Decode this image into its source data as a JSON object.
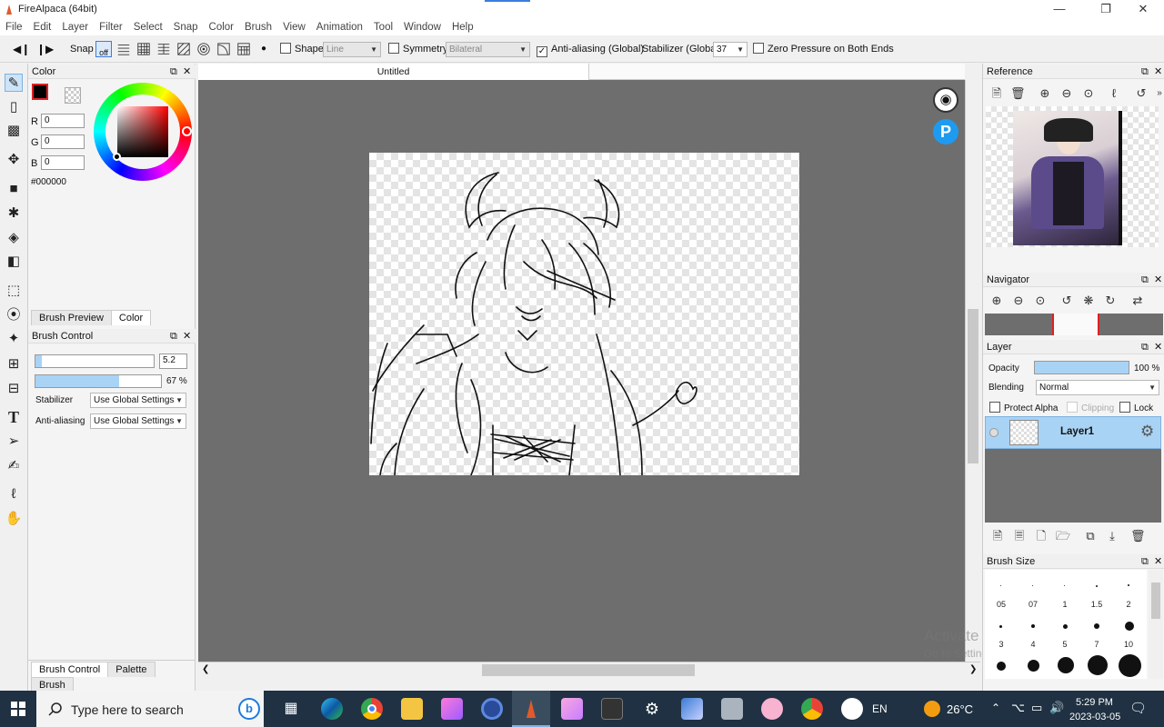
{
  "window": {
    "title": "FireAlpaca (64bit)"
  },
  "menu": [
    "File",
    "Edit",
    "Layer",
    "Filter",
    "Select",
    "Snap",
    "Color",
    "Brush",
    "View",
    "Animation",
    "Tool",
    "Window",
    "Help"
  ],
  "toolbar": {
    "snap_label": "Snap",
    "snap_off": "off",
    "shape_label": "Shape",
    "shape_value": "Line",
    "symmetry_label": "Symmetry",
    "symmetry_value": "Bilateral",
    "antialias_label": "Anti-aliasing (Global)",
    "stabilizer_label": "Stabilizer (Global)",
    "stabilizer_value": "37",
    "zero_pressure_label": "Zero Pressure on Both Ends"
  },
  "color_panel": {
    "title": "Color",
    "r_label": "R",
    "g_label": "G",
    "b_label": "B",
    "r": "0",
    "g": "0",
    "b": "0",
    "hex": "#000000"
  },
  "left_tabs": {
    "preview": "Brush Preview",
    "color": "Color"
  },
  "brush_control": {
    "title": "Brush Control",
    "size_value": "5.2",
    "opacity_value": "67 %",
    "opacity_fraction": 0.67,
    "stabilizer_label": "Stabilizer",
    "stabilizer_value": "Use Global Settings",
    "antialias_label": "Anti-aliasing",
    "antialias_value": "Use Global Settings"
  },
  "bottom_tabs": [
    "Brush Control",
    "Palette",
    "Brush"
  ],
  "document": {
    "tab_title": "Untitled"
  },
  "reference": {
    "title": "Reference"
  },
  "navigator": {
    "title": "Navigator"
  },
  "layer_panel": {
    "title": "Layer",
    "opacity_label": "Opacity",
    "opacity_value": "100 %",
    "blending_label": "Blending",
    "blending_value": "Normal",
    "protect_alpha": "Protect Alpha",
    "clipping": "Clipping",
    "lock": "Lock",
    "layers": [
      {
        "name": "Layer1"
      }
    ]
  },
  "brush_size": {
    "title": "Brush Size",
    "sizes": [
      "05",
      "07",
      "1",
      "1.5",
      "2",
      "3",
      "4",
      "5",
      "7",
      "10"
    ]
  },
  "watermark": {
    "line1": "Activate Windows",
    "line2": "Go to Settings to activate Windows."
  },
  "taskbar": {
    "search_placeholder": "Type here to search",
    "language": "EN",
    "temperature": "26°C",
    "time": "5:29 PM",
    "date": "2023-03-05"
  },
  "colors": {
    "accent": "#a9d3f5",
    "canvas_bg": "#6e6e6e",
    "taskbar": "#1f3142",
    "fg_color": "#000000"
  }
}
